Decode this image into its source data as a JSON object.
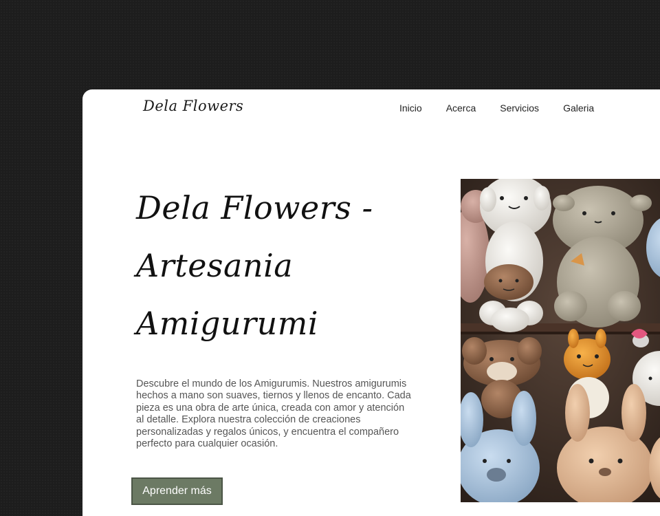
{
  "brand": {
    "logo_text": "Dela Flowers"
  },
  "nav": {
    "items": [
      "Inicio",
      "Acerca",
      "Servicios",
      "Galeria"
    ]
  },
  "hero": {
    "title": "Dela Flowers - Artesania Amigurumi",
    "description": "Descubre el mundo de los Amigurumis. Nuestros amigurumis hechos a mano son suaves, tiernos y llenos de encanto. Cada pieza es una obra de arte única, creada con amor y atención al detalle. Explora nuestra colección de creaciones personalizadas y regalos únicos, y encuentra el compañero perfecto para cualquier ocasión.",
    "cta_label": "Aprender más"
  },
  "colors": {
    "page_background": "#1d1d1d",
    "card_background": "#ffffff",
    "cta_background": "#6c7a64",
    "title_color": "#111111",
    "description_color": "#555555"
  }
}
